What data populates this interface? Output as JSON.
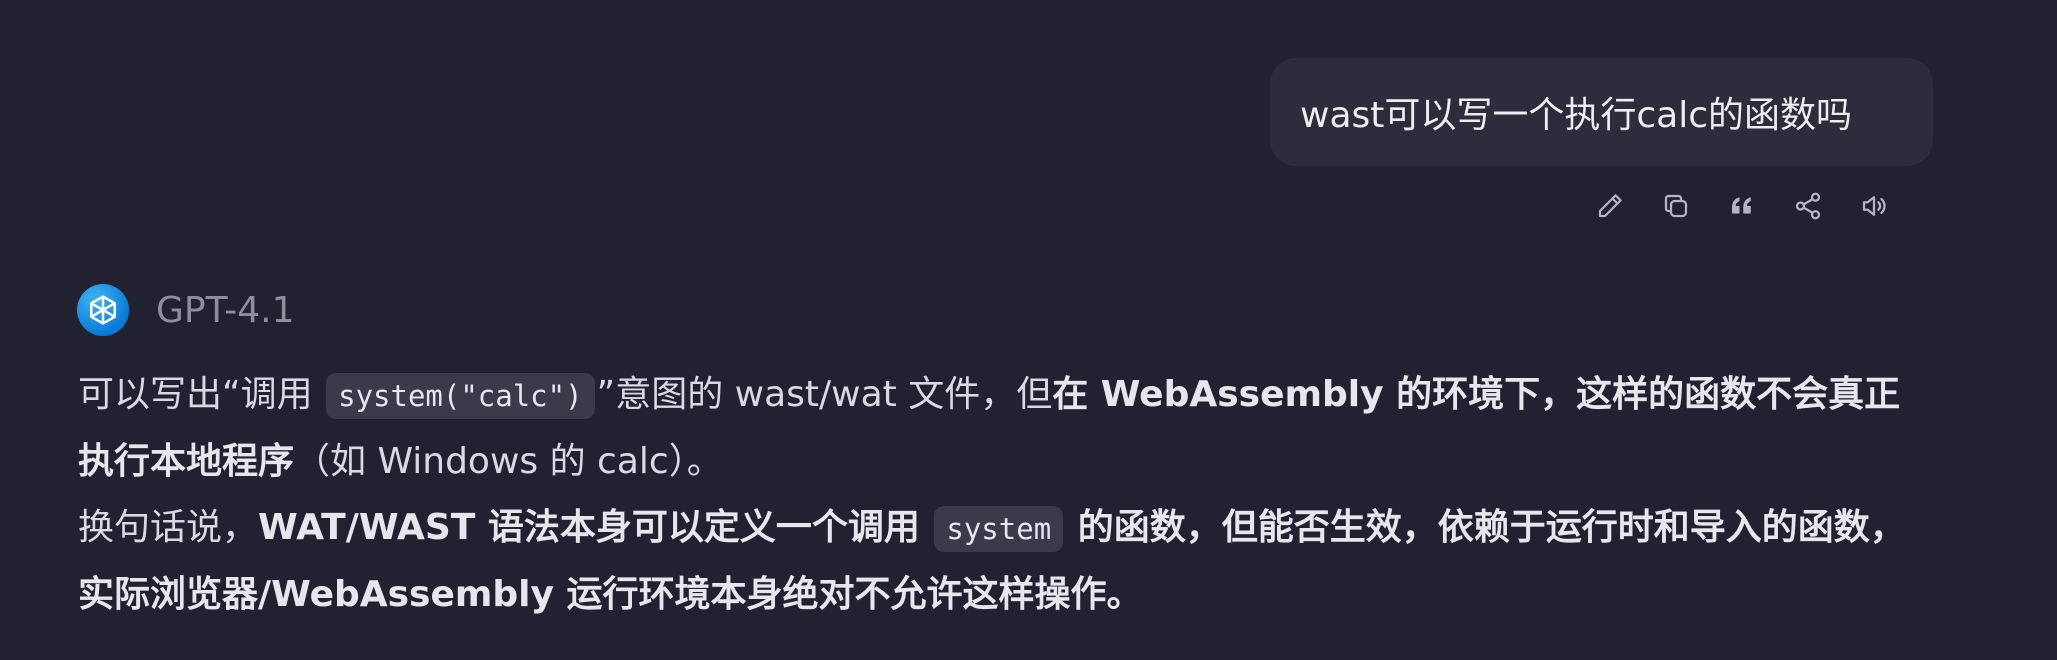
{
  "user_message": {
    "text": "wast可以写一个执行calc的函数吗"
  },
  "message_actions": [
    {
      "icon": "pencil-icon",
      "name": "edit-button"
    },
    {
      "icon": "copy-icon",
      "name": "copy-button"
    },
    {
      "icon": "quote-icon",
      "name": "quote-button"
    },
    {
      "icon": "share-icon",
      "name": "share-button"
    },
    {
      "icon": "speaker-icon",
      "name": "read-aloud-button"
    }
  ],
  "assistant": {
    "model_name": "GPT-4.1",
    "logo_icon": "openai-logo-icon",
    "p1": {
      "t1": "可以写出“调用 ",
      "code1": "system(\"calc\")",
      "t2": "”意图的 wast/wat 文件，但",
      "bold1": "在 WebAssembly 的环境下，这样的函数不会真正执行本地程序",
      "t3": "（如 Windows 的 calc）。"
    },
    "p2": {
      "t1": "换句话说，",
      "bold1": "WAT/WAST 语法本身可以定义一个调用 ",
      "code1": "system",
      "bold2": " 的函数，但能否生效，依赖于运行时和导入的函数，实际浏览器/WebAssembly 运行环境本身绝对不允许这样操作。"
    }
  },
  "colors": {
    "background": "#212130",
    "user_bubble": "#2c2c3b",
    "code_background": "#3a3a4a",
    "model_name": "#8e8ea0",
    "logo": "#0a7bd6"
  }
}
